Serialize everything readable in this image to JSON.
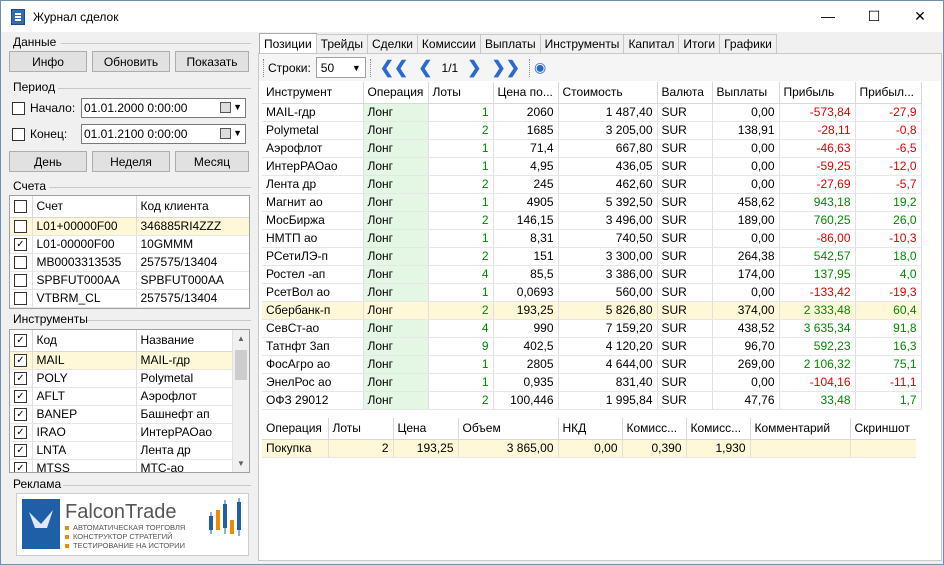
{
  "window": {
    "title": "Журнал сделок"
  },
  "data_group": {
    "label": "Данные",
    "info": "Инфо",
    "refresh": "Обновить",
    "show": "Показать"
  },
  "period": {
    "label": "Период",
    "start_label": "Начало:",
    "start_value": "01.01.2000   0:00:00",
    "end_label": "Конец:",
    "end_value": "01.01.2100   0:00:00",
    "day": "День",
    "week": "Неделя",
    "month": "Месяц"
  },
  "accounts": {
    "label": "Счета",
    "col_account": "Счет",
    "col_client": "Код клиента",
    "rows": [
      {
        "account": "L01+00000F00",
        "client": "346885RI4ZZZ",
        "checked": false
      },
      {
        "account": "L01-00000F00",
        "client": "10GMMM",
        "checked": true
      },
      {
        "account": "MB0003313535",
        "client": "257575/13404",
        "checked": false
      },
      {
        "account": "SPBFUT000AA",
        "client": "SPBFUT000AA",
        "checked": false
      },
      {
        "account": "VTBRM_CL",
        "client": "257575/13404",
        "checked": false
      }
    ]
  },
  "instruments": {
    "label": "Инструменты",
    "col_code": "Код",
    "col_name": "Название",
    "rows": [
      {
        "code": "MAIL",
        "name": "MAIL-гдр",
        "checked": true
      },
      {
        "code": "POLY",
        "name": "Polymetal",
        "checked": true
      },
      {
        "code": "AFLT",
        "name": "Аэрофлот",
        "checked": true
      },
      {
        "code": "BANEP",
        "name": "Башнефт ап",
        "checked": true
      },
      {
        "code": "IRAO",
        "name": "ИнтерРАОао",
        "checked": true
      },
      {
        "code": "LNTA",
        "name": "Лента др",
        "checked": true
      },
      {
        "code": "MTSS",
        "name": "МТС-ао",
        "checked": true
      }
    ]
  },
  "ads": {
    "label": "Реклама",
    "brand": "FalconTrade",
    "lines": [
      "АВТОМАТИЧЕСКАЯ ТОРГОВЛЯ",
      "КОНСТРУКТОР СТРАТЕГИЙ",
      "ТЕСТИРОВАНИЕ НА ИСТОРИИ"
    ]
  },
  "tabs": [
    "Позиции",
    "Трейды",
    "Сделки",
    "Комиссии",
    "Выплаты",
    "Инструменты",
    "Капитал",
    "Итоги",
    "Графики"
  ],
  "toolbar": {
    "rows_label": "Строки:",
    "rows_value": "50",
    "page": "1/1"
  },
  "positions": {
    "columns": [
      "Инструмент",
      "Операция",
      "Лоты",
      "Цена по...",
      "Стоимость",
      "Валюта",
      "Выплаты",
      "Прибыль",
      "Прибыл..."
    ],
    "rows": [
      [
        "MAIL-гдр",
        "Лонг",
        "1",
        "2060",
        "1 487,40",
        "SUR",
        "0,00",
        "-573,84",
        "-27,9"
      ],
      [
        "Polymetal",
        "Лонг",
        "2",
        "1685",
        "3 205,00",
        "SUR",
        "138,91",
        "-28,11",
        "-0,8"
      ],
      [
        "Аэрофлот",
        "Лонг",
        "1",
        "71,4",
        "667,80",
        "SUR",
        "0,00",
        "-46,63",
        "-6,5"
      ],
      [
        "ИнтерРАОао",
        "Лонг",
        "1",
        "4,95",
        "436,05",
        "SUR",
        "0,00",
        "-59,25",
        "-12,0"
      ],
      [
        "Лента др",
        "Лонг",
        "2",
        "245",
        "462,60",
        "SUR",
        "0,00",
        "-27,69",
        "-5,7"
      ],
      [
        "Магнит ао",
        "Лонг",
        "1",
        "4905",
        "5 392,50",
        "SUR",
        "458,62",
        "943,18",
        "19,2"
      ],
      [
        "МосБиржа",
        "Лонг",
        "2",
        "146,15",
        "3 496,00",
        "SUR",
        "189,00",
        "760,25",
        "26,0"
      ],
      [
        "НМТП ао",
        "Лонг",
        "1",
        "8,31",
        "740,50",
        "SUR",
        "0,00",
        "-86,00",
        "-10,3"
      ],
      [
        "РСетиЛЭ-п",
        "Лонг",
        "2",
        "151",
        "3 300,00",
        "SUR",
        "264,38",
        "542,57",
        "18,0"
      ],
      [
        "Ростел -ап",
        "Лонг",
        "4",
        "85,5",
        "3 386,00",
        "SUR",
        "174,00",
        "137,95",
        "4,0"
      ],
      [
        "РсетВол ао",
        "Лонг",
        "1",
        "0,0693",
        "560,00",
        "SUR",
        "0,00",
        "-133,42",
        "-19,3"
      ],
      [
        "Сбербанк-п",
        "Лонг",
        "2",
        "193,25",
        "5 826,80",
        "SUR",
        "374,00",
        "2 333,48",
        "60,4"
      ],
      [
        "СевСт-ао",
        "Лонг",
        "4",
        "990",
        "7 159,20",
        "SUR",
        "438,52",
        "3 635,34",
        "91,8"
      ],
      [
        "Татнфт 3ап",
        "Лонг",
        "9",
        "402,5",
        "4 120,20",
        "SUR",
        "96,70",
        "592,23",
        "16,3"
      ],
      [
        "ФосАгро ао",
        "Лонг",
        "1",
        "2805",
        "4 644,00",
        "SUR",
        "269,00",
        "2 106,32",
        "75,1"
      ],
      [
        "ЭнелРос ао",
        "Лонг",
        "1",
        "0,935",
        "831,40",
        "SUR",
        "0,00",
        "-104,16",
        "-11,1"
      ],
      [
        "ОФЗ 29012",
        "Лонг",
        "2",
        "100,446",
        "1 995,84",
        "SUR",
        "47,76",
        "33,48",
        "1,7"
      ]
    ]
  },
  "trades": {
    "columns": [
      "Операция",
      "Лоты",
      "Цена",
      "Объем",
      "НКД",
      "Комисс...",
      "Комисс...",
      "Комментарий",
      "Скриншот"
    ],
    "rows": [
      [
        "Покупка",
        "2",
        "193,25",
        "3 865,00",
        "0,00",
        "0,390",
        "1,930",
        "",
        ""
      ]
    ]
  },
  "colors": {
    "profit": "#008800",
    "loss": "#e00000",
    "selected_row": "#fff8d8",
    "long_cell": "#e4f6e4",
    "accent": "#2a6ad0"
  }
}
